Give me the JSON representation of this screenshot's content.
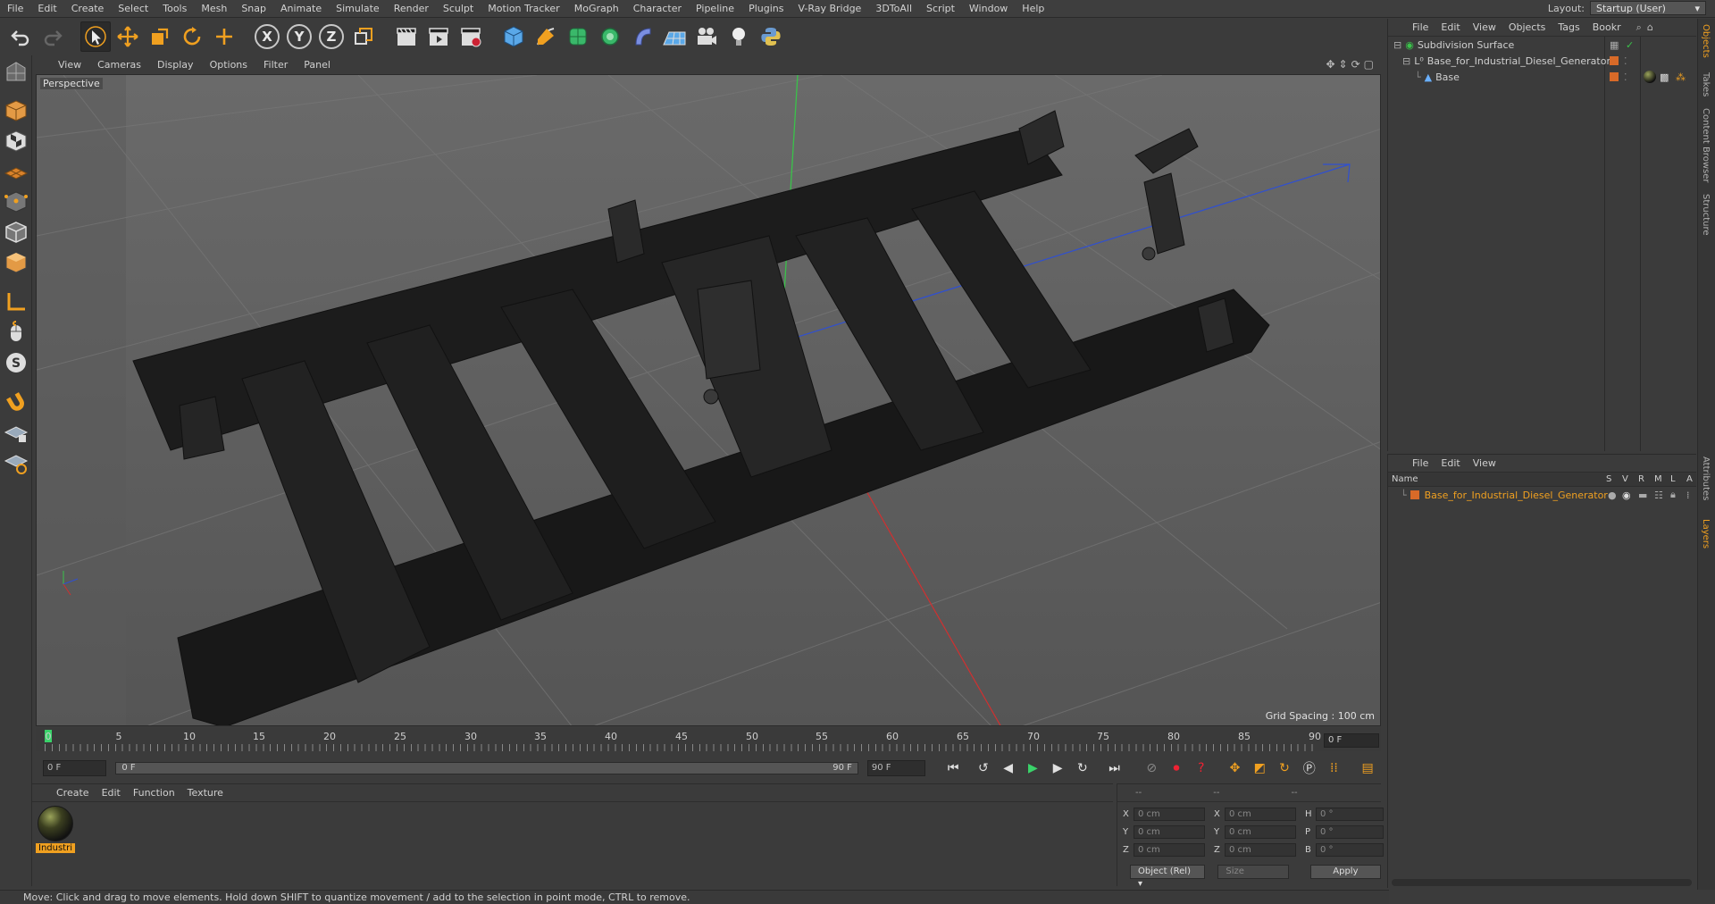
{
  "menubar": {
    "items": [
      "File",
      "Edit",
      "Create",
      "Select",
      "Tools",
      "Mesh",
      "Snap",
      "Animate",
      "Simulate",
      "Render",
      "Sculpt",
      "Motion Tracker",
      "MoGraph",
      "Character",
      "Pipeline",
      "Plugins",
      "V-Ray Bridge",
      "3DToAll",
      "Script",
      "Window",
      "Help"
    ],
    "layout_label": "Layout:",
    "layout_value": "Startup (User)"
  },
  "toolbar": {
    "axis_x": "X",
    "axis_y": "Y",
    "axis_z": "Z"
  },
  "viewport": {
    "menu": [
      "View",
      "Cameras",
      "Display",
      "Options",
      "Filter",
      "Panel"
    ],
    "label": "Perspective",
    "grid_spacing": "Grid Spacing : 100 cm"
  },
  "timeline": {
    "ticks": [
      "0",
      "5",
      "10",
      "15",
      "20",
      "25",
      "30",
      "35",
      "40",
      "45",
      "50",
      "55",
      "60",
      "65",
      "70",
      "75",
      "80",
      "85",
      "90"
    ],
    "current_frame": "0 F"
  },
  "transport": {
    "start_field": "0 F",
    "range_start": "0 F",
    "range_end": "90 F",
    "end_field": "90 F"
  },
  "material_manager": {
    "menu": [
      "Create",
      "Edit",
      "Function",
      "Texture"
    ],
    "materials": [
      {
        "name": "Industri"
      }
    ]
  },
  "coordinates": {
    "headers": [
      "--",
      "--",
      "--"
    ],
    "rows": [
      {
        "a": "X",
        "av": "0 cm",
        "b": "X",
        "bv": "0 cm",
        "c": "H",
        "cv": "0 °"
      },
      {
        "a": "Y",
        "av": "0 cm",
        "b": "Y",
        "bv": "0 cm",
        "c": "P",
        "cv": "0 °"
      },
      {
        "a": "Z",
        "av": "0 cm",
        "b": "Z",
        "bv": "0 cm",
        "c": "B",
        "cv": "0 °"
      }
    ],
    "mode": "Object (Rel)",
    "size": "Size",
    "apply": "Apply"
  },
  "status": {
    "text": "Move: Click and drag to move elements. Hold down SHIFT to quantize movement / add to the selection in point mode, CTRL to remove."
  },
  "object_manager": {
    "menu": [
      "File",
      "Edit",
      "View",
      "Objects",
      "Tags",
      "Bookr"
    ],
    "objects": [
      {
        "name": "Subdivision Surface"
      },
      {
        "name": "Base_for_Industrial_Diesel_Generator"
      },
      {
        "name": "Base"
      }
    ]
  },
  "layer_manager": {
    "menu": [
      "File",
      "Edit",
      "View"
    ],
    "columns": [
      "Name",
      "S",
      "V",
      "R",
      "M",
      "L",
      "A"
    ],
    "rows": [
      {
        "name": "Base_for_Industrial_Diesel_Generator"
      }
    ]
  },
  "side_tabs": [
    "Objects",
    "Takes",
    "Content Browser",
    "Structure",
    "Attributes",
    "Layers"
  ],
  "colors": {
    "accent": "#f0a020",
    "active_marker": "#3ad36a",
    "layer_swatch": "#d86a28"
  }
}
